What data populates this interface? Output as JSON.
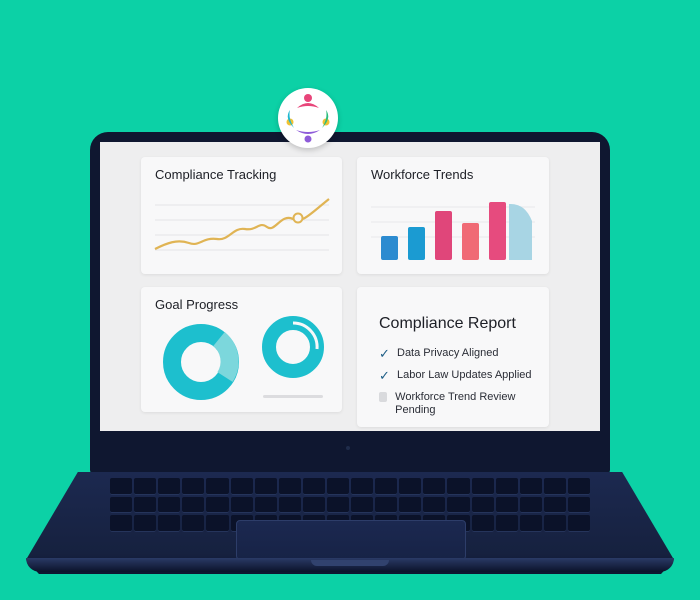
{
  "badge": {
    "icon": "team-circle-icon"
  },
  "cards": {
    "compliance_tracking": {
      "title": "Compliance Tracking"
    },
    "workforce_trends": {
      "title": "Workforce Trends"
    },
    "goal_progress": {
      "title": "Goal Progress"
    },
    "compliance_report": {
      "title": "Compliance Report",
      "items": [
        {
          "label": "Data Privacy Aligned",
          "status": "done"
        },
        {
          "label": "Labor Law Updates Applied",
          "status": "done"
        },
        {
          "label": "Workforce Trend Review Pending",
          "status": "pending"
        }
      ]
    }
  },
  "colors": {
    "background": "#0cd1a6",
    "line": "#e0b454",
    "donut": "#1dbfce",
    "donut_light": "#7cd7dc",
    "bars": [
      "#2c8bd0",
      "#1b9bd2",
      "#e0467a",
      "#f06a75",
      "#e64b7e",
      "#a8d5e4"
    ]
  }
}
